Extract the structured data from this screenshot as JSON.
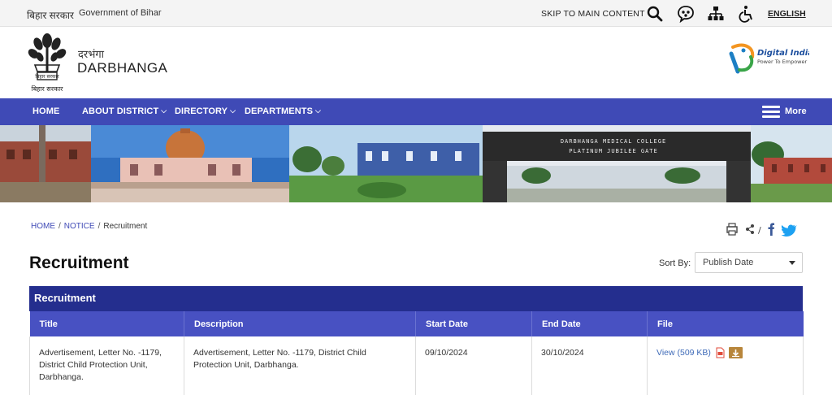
{
  "topbar": {
    "hindi_label": "बिहार सरकार",
    "gov_label": "Government of Bihar",
    "skip_label": "SKIP TO MAIN CONTENT",
    "language_label": "ENGLISH",
    "icons": [
      "search-icon",
      "sitemap-social-icon",
      "sitemap-icon",
      "accessibility-icon"
    ]
  },
  "header": {
    "district_hindi": "दरभंगा",
    "district_name": "DARBHANGA",
    "emblem_caption": "बिहार सरकार",
    "digital_india_title": "Digital India",
    "digital_india_tagline": "Power To Empower"
  },
  "nav": {
    "items": [
      {
        "label": "HOME"
      },
      {
        "label": "ABOUT DISTRICT"
      },
      {
        "label": "DIRECTORY"
      },
      {
        "label": "DEPARTMENTS"
      }
    ],
    "more_label": "More",
    "colors": {
      "nav_bg": "#3f4ab6",
      "table_head": "#242e8e"
    }
  },
  "banner": {
    "gate_line1": "DARBHANGA MEDICAL COLLEGE",
    "gate_line2": "PLATINUM JUBILEE GATE"
  },
  "breadcrumb": {
    "home": "HOME",
    "notice": "NOTICE",
    "current": "Recruitment"
  },
  "page": {
    "title": "Recruitment",
    "sort_label": "Sort By:",
    "sort_value": "Publish Date",
    "section_title": "Recruitment"
  },
  "table": {
    "columns": [
      "Title",
      "Description",
      "Start Date",
      "End Date",
      "File"
    ],
    "rows": [
      {
        "title": "Advertisement, Letter No. -1179, District Child Protection Unit, Darbhanga.",
        "description": "Advertisement, Letter No. -1179, District Child Protection Unit, Darbhanga.",
        "start_date": "09/10/2024",
        "end_date": "30/10/2024",
        "file_label": "View (509 KB)"
      }
    ]
  }
}
